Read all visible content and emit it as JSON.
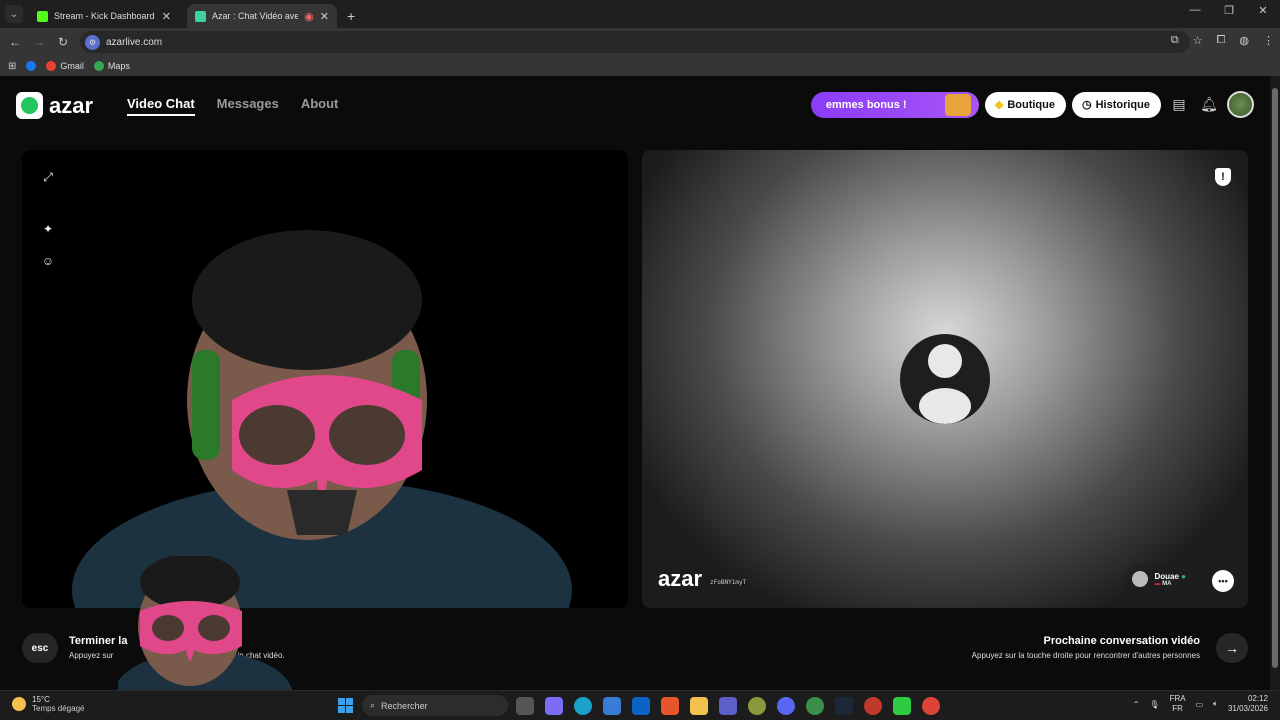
{
  "browser": {
    "tabs": [
      {
        "title": "Stream - Kick Dashboard",
        "favicon_color": "#53fc18",
        "active": false
      },
      {
        "title": "Azar : Chat Vidéo avec de n",
        "favicon_color": "#3fd0a0",
        "active": true
      }
    ],
    "url": "azarlive.com",
    "bookmarks": [
      {
        "label": "",
        "color": "#1877f2"
      },
      {
        "label": "Gmail",
        "color": "#ea4335"
      },
      {
        "label": "Maps",
        "color": "#34a853"
      }
    ]
  },
  "header": {
    "logo_text": "azar",
    "nav": [
      {
        "label": "Video Chat",
        "active": true
      },
      {
        "label": "Messages",
        "active": false
      },
      {
        "label": "About",
        "active": false
      }
    ],
    "bonus_label": "emmes bonus !",
    "shop_label": "Boutique",
    "history_label": "Historique"
  },
  "remote": {
    "watermark": "azar",
    "user_id": "zFoBNY1myT",
    "peer_name": "Douae",
    "peer_country": "MA"
  },
  "controls": {
    "esc_label": "esc",
    "end_title": "Terminer la",
    "end_hint_a": "Appuyez sur",
    "end_hint_b": "in",
    "end_hint_c": "chat vidéo.",
    "next_title": "Prochaine conversation vidéo",
    "next_hint": "Appuyez sur la touche droite pour rencontrer d'autres personnes",
    "next_arrow": "→"
  },
  "taskbar": {
    "temperature": "15°C",
    "weather_text": "Temps dégagé",
    "search_placeholder": "Rechercher",
    "lang_top": "FRA",
    "lang_bottom": "FR",
    "time": "02:12",
    "date": "31/03/2026"
  },
  "colors": {
    "accent_green": "#22c55e",
    "bonus_purple": "#8b3cf6"
  }
}
